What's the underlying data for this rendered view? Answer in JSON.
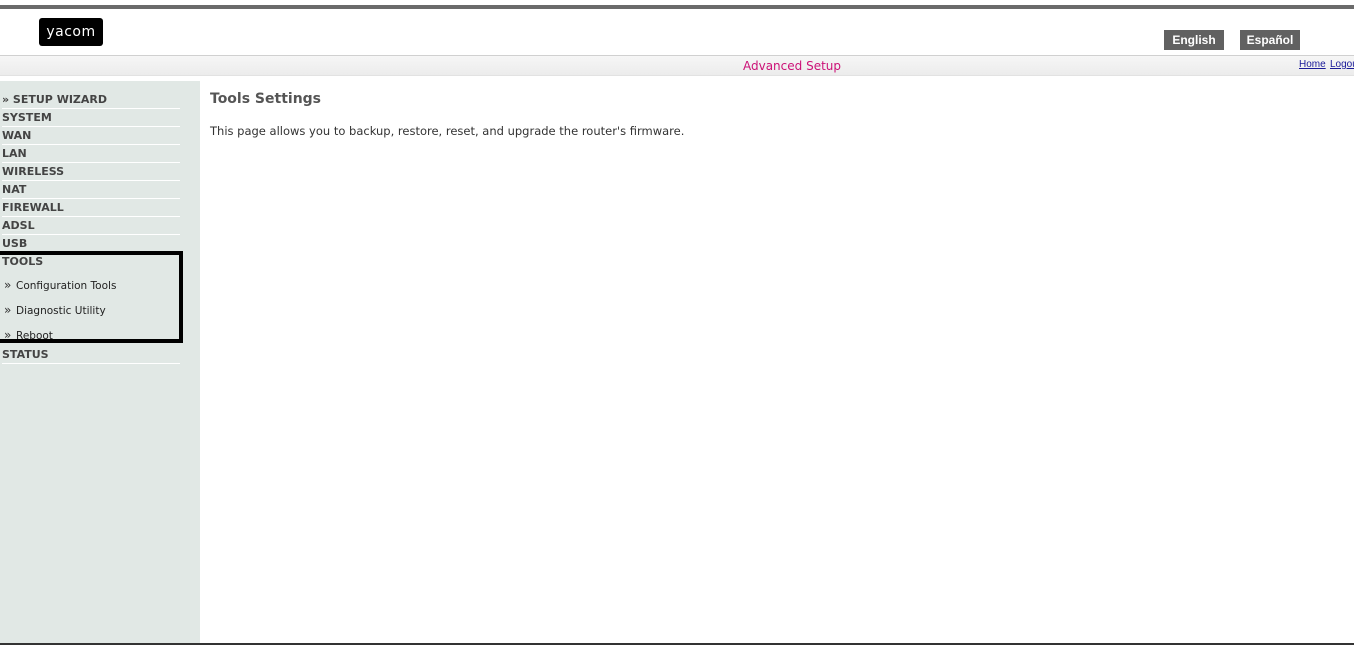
{
  "header": {
    "logo_text": "yacom",
    "lang_english": "English",
    "lang_espanol": "Español",
    "title": "Advanced Setup",
    "home_link": "Home",
    "logout_link": "Logou"
  },
  "sidebar": {
    "items": [
      {
        "label": "» SETUP WIZARD"
      },
      {
        "label": "SYSTEM"
      },
      {
        "label": "WAN"
      },
      {
        "label": "LAN"
      },
      {
        "label": "WIRELESS"
      },
      {
        "label": "NAT"
      },
      {
        "label": "FIREWALL"
      },
      {
        "label": "ADSL"
      },
      {
        "label": "USB"
      },
      {
        "label": "TOOLS"
      },
      {
        "label": "STATUS"
      }
    ],
    "tools_subitems": [
      {
        "label": "Configuration Tools"
      },
      {
        "label": "Diagnostic Utility"
      },
      {
        "label": "Reboot"
      }
    ],
    "chevron": "»"
  },
  "main": {
    "title": "Tools Settings",
    "description": "This page allows you to backup, restore, reset, and upgrade the router's firmware."
  },
  "colors": {
    "title_accent": "#cc1177",
    "sidebar_bg": "#e1e8e5",
    "lang_button_bg": "#616161"
  }
}
